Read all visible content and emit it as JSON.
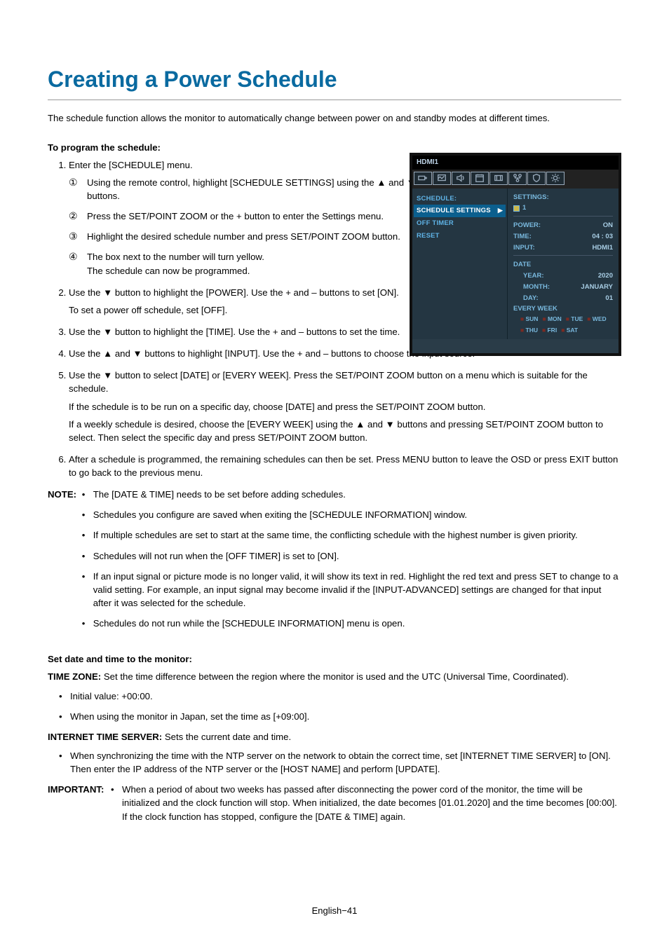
{
  "title": "Creating a Power Schedule",
  "intro": "The schedule function allows the monitor to automatically change between power on and standby modes at different times.",
  "prog_head": "To program the schedule:",
  "steps": {
    "s1": "Enter the [SCHEDULE] menu.",
    "s1a": "Using the remote control, highlight [SCHEDULE SETTINGS] using the ▲ and ▼ buttons.",
    "s1b": "Press the SET/POINT ZOOM or the + button to enter the Settings menu.",
    "s1c": "Highlight the desired schedule number and press SET/POINT ZOOM button.",
    "s1d_a": "The box next to the number will turn yellow.",
    "s1d_b": "The schedule can now be programmed.",
    "s2": "Use the ▼ button to highlight the [POWER]. Use the + and – buttons to set [ON].",
    "s2b": "To set a power off schedule, set [OFF].",
    "s3": "Use the ▼ button to highlight the [TIME]. Use the + and – buttons to set the time.",
    "s4": "Use the ▲ and ▼ buttons to highlight [INPUT]. Use the + and – buttons to choose the input source.",
    "s5a": "Use the ▼ button to select [DATE] or [EVERY WEEK]. Press the SET/POINT ZOOM button on a menu which is suitable for the schedule.",
    "s5b": "If the schedule is to be run on a specific day, choose [DATE] and press the SET/POINT ZOOM button.",
    "s5c": "If a weekly schedule is desired, choose the [EVERY WEEK] using the ▲ and ▼ buttons and pressing SET/POINT ZOOM button to select. Then select the specific day and press SET/POINT ZOOM button.",
    "s6": "After a schedule is programmed, the remaining schedules can then be set. Press MENU button to leave the OSD or press EXIT button to go back to the previous menu."
  },
  "note_label": "NOTE: ",
  "notes": {
    "n1": "The [DATE & TIME] needs to be set before adding schedules.",
    "n2": "Schedules you configure are saved when exiting the [SCHEDULE INFORMATION] window.",
    "n3": "If multiple schedules are set to start at the same time, the conflicting schedule with the highest number is given priority.",
    "n4": "Schedules will not run when the [OFF TIMER] is set to [ON].",
    "n5": "If an input signal or picture mode is no longer valid, it will show its text in red. Highlight the red text and press SET to change to a valid setting. For example, an input signal may become invalid if the [INPUT-ADVANCED] settings are changed for that input after it was selected for the schedule.",
    "n6": "Schedules do not run while the [SCHEDULE INFORMATION] menu is open."
  },
  "dt_head": "Set date and time to the monitor:",
  "tz_label": "TIME ZONE:",
  "tz_text": " Set the time difference between the region where the monitor is used and the UTC (Universal Time, Coordinated).",
  "tz_b1": "Initial value: +00:00.",
  "tz_b2": "When using the monitor in Japan, set the time as [+09:00].",
  "its_label": "INTERNET TIME SERVER:",
  "its_text": " Sets the current date and time.",
  "its_b1": "When synchronizing the time with the NTP server on the network to obtain the correct time, set [INTERNET TIME SERVER] to [ON]. Then enter the IP address of the NTP server or the [HOST NAME] and perform [UPDATE].",
  "imp_label": "IMPORTANT: ",
  "imp_b1": "When a period of about two weeks has passed after disconnecting the power cord of the monitor, the time will be initialized and the clock function will stop. When initialized, the date becomes [01.01.2020] and the time becomes [00:00]. If the clock function has stopped, configure the [DATE & TIME] again.",
  "footer": "English−41",
  "osd": {
    "input": "HDMI1",
    "menu_title": "SCHEDULE:",
    "left_items": [
      "SCHEDULE SETTINGS",
      "OFF TIMER",
      "RESET"
    ],
    "settings_label": "SETTINGS:",
    "settings_index": "1",
    "rows": {
      "power_l": "POWER:",
      "power_v": "ON",
      "time_l": "TIME:",
      "time_v": "04 : 03",
      "input_l": "INPUT:",
      "input_v": "HDMI1",
      "date_l": "DATE",
      "year_l": "YEAR:",
      "year_v": "2020",
      "month_l": "MONTH:",
      "month_v": "JANUARY",
      "day_l": "DAY:",
      "day_v": "01",
      "week_l": "EVERY WEEK"
    },
    "days": [
      "SUN",
      "MON",
      "TUE",
      "WED",
      "THU",
      "FRI",
      "SAT"
    ]
  }
}
